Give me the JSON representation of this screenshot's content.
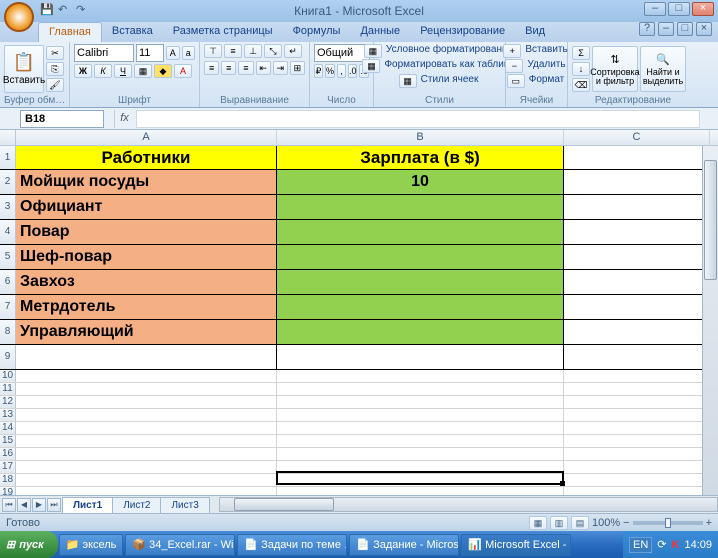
{
  "window": {
    "title": "Книга1 - Microsoft Excel"
  },
  "tabs": [
    "Главная",
    "Вставка",
    "Разметка страницы",
    "Формулы",
    "Данные",
    "Рецензирование",
    "Вид"
  ],
  "active_tab": 0,
  "ribbon": {
    "clipboard": {
      "paste": "Вставить",
      "label": "Буфер обм…"
    },
    "font": {
      "name": "Calibri",
      "size": "11",
      "label": "Шрифт"
    },
    "align": {
      "label": "Выравнивание"
    },
    "number": {
      "format": "Общий",
      "label": "Число"
    },
    "styles": {
      "cond": "Условное форматирование",
      "table": "Форматировать как таблицу",
      "cell": "Стили ячеек",
      "label": "Стили"
    },
    "cells": {
      "insert": "Вставить",
      "delete": "Удалить",
      "format": "Формат",
      "label": "Ячейки"
    },
    "editing": {
      "sort": "Сортировка и фильтр",
      "find": "Найти и выделить",
      "label": "Редактирование"
    }
  },
  "namebox": "B18",
  "columns": [
    "A",
    "B",
    "C"
  ],
  "chart_data": {
    "type": "table",
    "headers": [
      "Работники",
      "Зарплата (в $)"
    ],
    "rows": [
      {
        "worker": "Мойщик посуды",
        "salary": "10"
      },
      {
        "worker": "Официант",
        "salary": ""
      },
      {
        "worker": "Повар",
        "salary": ""
      },
      {
        "worker": "Шеф-повар",
        "salary": ""
      },
      {
        "worker": "Завхоз",
        "salary": ""
      },
      {
        "worker": "Метрдотель",
        "salary": ""
      },
      {
        "worker": "Управляющий",
        "salary": ""
      }
    ]
  },
  "sheets": [
    "Лист1",
    "Лист2",
    "Лист3"
  ],
  "active_sheet": 0,
  "status": {
    "ready": "Готово",
    "zoom": "100%"
  },
  "taskbar": {
    "start": "пуск",
    "items": [
      "эксель",
      "34_Excel.rar - Wi…",
      "Задачи по теме …",
      "Задание - Micros…",
      "Microsoft Excel - …"
    ],
    "lang": "EN",
    "time": "14:09"
  }
}
